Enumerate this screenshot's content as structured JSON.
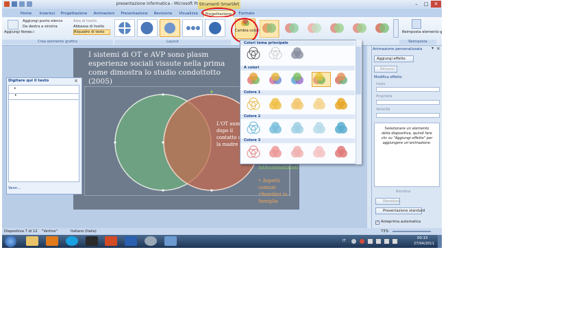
{
  "window": {
    "title": "presentazione informatica - Microsoft PowerPoint",
    "contextual_tab_title": "Strumenti SmartArt"
  },
  "tabs": [
    "Home",
    "Inserisci",
    "Progettazione",
    "Animazioni",
    "Presentazione",
    "Revisione",
    "Visualizza",
    "Progettazione",
    "Formato"
  ],
  "ribbon": {
    "create_graphic": {
      "add_shape": "Aggiungi forma",
      "add_bullet": "Aggiungi punto elenco",
      "right_to_left": "Da destra a sinistra",
      "layout": "Layout",
      "promote": "Alza di livello",
      "demote": "Abbassa di livello",
      "text_pane": "Riquadro di testo",
      "group_label": "Crea elemento grafico"
    },
    "layout_group_label": "Layout",
    "change_colors": "Cambia colori",
    "reset_graphic": "Reimposta elemento grafico",
    "reset_group_label": "Reimposta"
  },
  "text_pane": {
    "title": "Digitare qui il testo",
    "footer": "Venn..."
  },
  "slide": {
    "heading": "I sistemi di OT e AVP sono plasm esperienze sociali vissute nella prima come dimostra lo studio condottotto (2005)",
    "venn_text_right": "L'OT aum dopo il contatto c la madre",
    "overflow_items": [
      "Istituzionalizzati",
      "• Aspetti comuni",
      "•Bambini in famiglia"
    ]
  },
  "colors_menu": {
    "sections": [
      "Colori tema principale",
      "A colori",
      "Colore 1",
      "Colore 2",
      "Colore 3"
    ]
  },
  "animation_pane": {
    "title": "Animazione personalizzata",
    "add_effect": "Aggiungi effetto",
    "remove": "Rimuovi",
    "modify_effect": "Modifica effetto",
    "start_label": "Inizio",
    "property_label": "Proprietà",
    "speed_label": "Velocità",
    "hint": "Selezionare un elemento della diapositiva, quindi fare clic su \"Aggiungi effetto\" per aggiungere un'animazione.",
    "reorder": "Riordina",
    "play": "Riproduci",
    "slideshow": "Presentazione standard",
    "autopreview": "Anteprima automatica"
  },
  "status_bar": {
    "slide_info": "Diapositiva 7 di 12",
    "theme": "\"Vertice\"",
    "language": "Italiano (Italia)",
    "zoom": "73%"
  },
  "taskbar": {
    "lang": "IT",
    "time": "00:15",
    "date": "27/04/2011"
  }
}
